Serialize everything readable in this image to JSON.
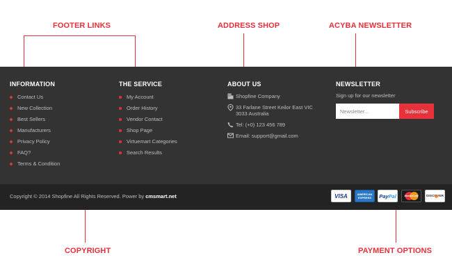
{
  "callouts": {
    "footer_links": "FOOTER LINKS",
    "address_shop": "ADDRESS SHOP",
    "acyba_newsletter": "ACYBA NEWSLETTER",
    "copyright": "COPYRIGHT",
    "payment_options": "PAYMENT OPTIONS"
  },
  "information": {
    "title": "INFORMATION",
    "links": [
      "Contact Us",
      "New Collection",
      "Best Sellers",
      "Manufacturers",
      "Privacy Policy",
      "FAQ?",
      "Terms & Condition"
    ]
  },
  "service": {
    "title": "THE SERVICE",
    "links": [
      "My Account",
      "Order History",
      "Vendor Contact",
      "Shop Page",
      "Virtuemart Categories",
      "Search Results"
    ]
  },
  "about": {
    "title": "ABOUT US",
    "company": "Shopfine Company",
    "address_line1": "33 Farlane Street Keilor East VIC",
    "address_line2": "3033 Australia",
    "tel": "Tel: (+0) 123 456 789",
    "email": "Email: support@gmail.com"
  },
  "newsletter": {
    "title": "NEWSLETTER",
    "description": "Sign up for our newsletter",
    "placeholder": "Newsletter...",
    "button": "Subscribe"
  },
  "bottom": {
    "copyright_text": "Copyright © 2014 Shopfine All Rights Reserved. Power by ",
    "brand": "cmsmart.net"
  },
  "payments": {
    "visa": "VISA",
    "amex_line1": "AMERICAN",
    "amex_line2": "EXPRESS",
    "paypal_pay": "Pay",
    "paypal_pal": "Pal",
    "mastercard": "MasterCard",
    "discover": "DISCOVER"
  },
  "colors": {
    "accent": "#e8303a",
    "footer_bg": "#333333",
    "bottom_bg": "#232323"
  }
}
